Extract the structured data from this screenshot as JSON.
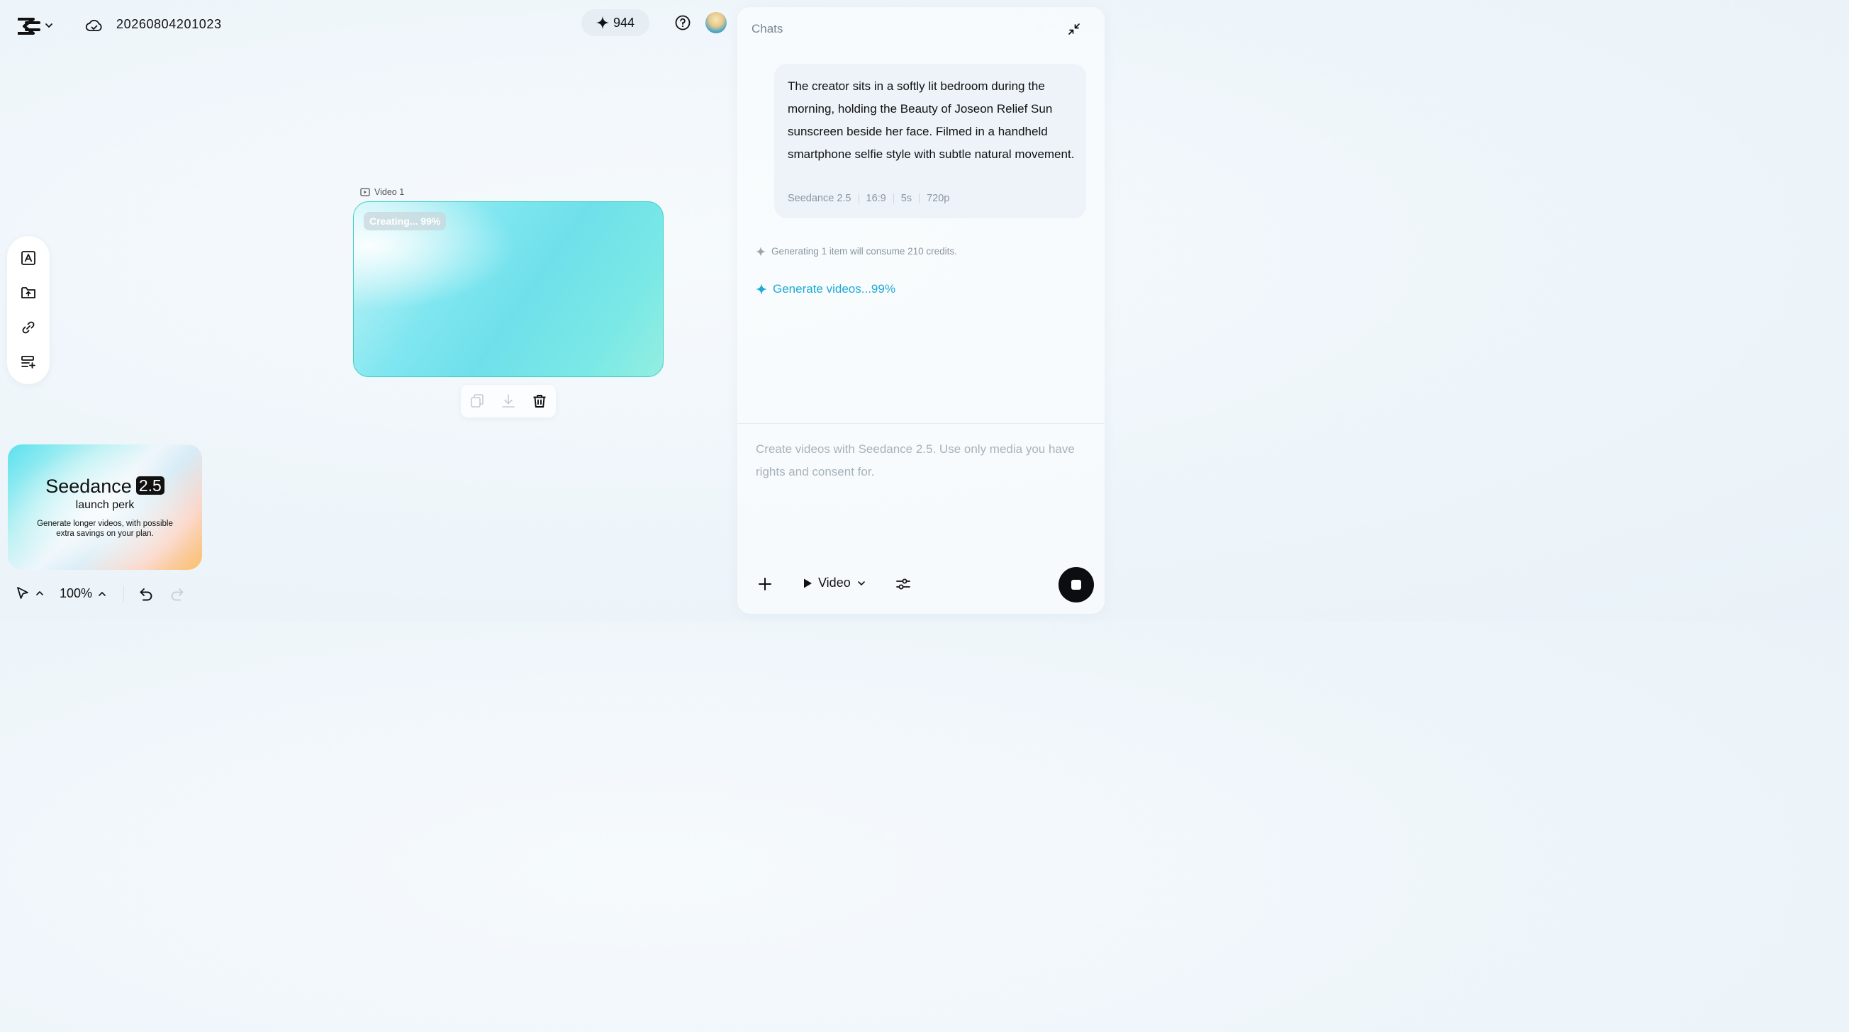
{
  "app": {
    "logo_icon": "capcut-logo-icon"
  },
  "header": {
    "project_name": "20260804201023",
    "credits": "944",
    "cloud_icon": "cloud-sync-icon",
    "help_icon": "help-icon"
  },
  "left_toolbar": {
    "tools": [
      "text-box-icon",
      "upload-folder-icon",
      "link-icon",
      "add-list-icon"
    ]
  },
  "canvas": {
    "video_label": "Video 1",
    "status_badge": "Creating... 99%",
    "progress": 0.99,
    "actions": [
      "copy-icon",
      "download-icon",
      "delete-icon"
    ]
  },
  "promo": {
    "title": "Seedance",
    "version": "2.5",
    "subtitle": "launch perk",
    "description": "Generate longer videos, with possible extra savings on your plan."
  },
  "bottom_controls": {
    "zoom": "100%"
  },
  "chat": {
    "title": "Chats",
    "user_message": "The creator sits in a softly lit bedroom during the morning, holding the Beauty of Joseon Relief Sun sunscreen beside her face. Filmed in a handheld smartphone selfie style with subtle natural movement.",
    "meta": [
      "Seedance 2.5",
      "16:9",
      "5s",
      "720p"
    ],
    "credit_note": "Generating 1 item will consume 210 credits.",
    "generate_status": "Generate videos...99%",
    "input_placeholder": "Create videos with Seedance 2.5. Use only media you have rights and consent for.",
    "mode": "Video"
  },
  "colors": {
    "accent": "#1fa9d6",
    "frame_border": "#3fd0c4",
    "stop_button": "#0b0d10"
  }
}
